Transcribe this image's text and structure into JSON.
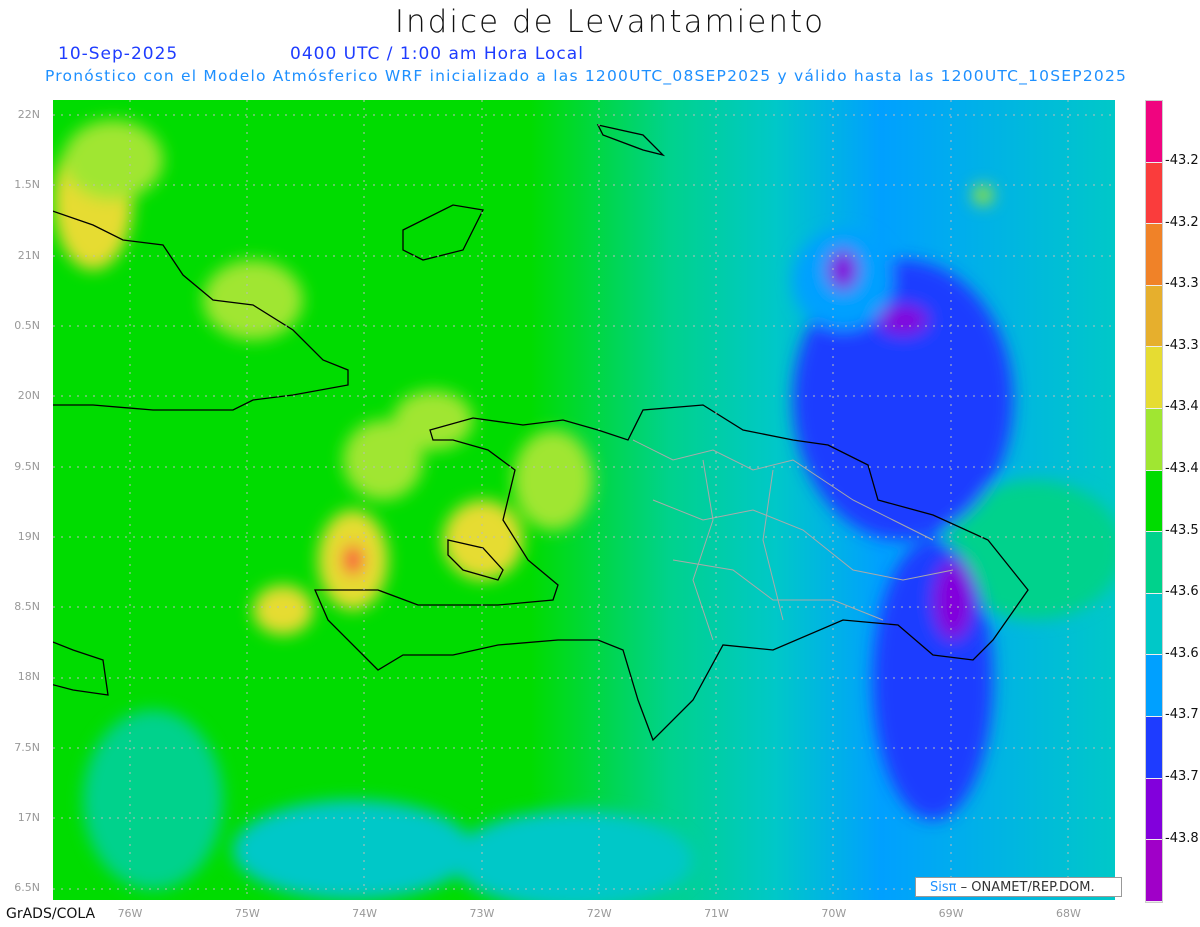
{
  "title": "Indice de Levantamiento",
  "date": "10-Sep-2025",
  "time": "0400 UTC / 1:00 am Hora Local",
  "subtitle": "Pronóstico con el Modelo Atmósferico WRF inicializado a las 1200UTC_08SEP2025 y válido hasta las  1200UTC_10SEP2025",
  "y_axis": [
    "22N",
    "1.5N",
    "21N",
    "0.5N",
    "20N",
    "9.5N",
    "19N",
    "8.5N",
    "18N",
    "7.5N",
    "17N",
    "6.5N"
  ],
  "x_axis": [
    "76W",
    "75W",
    "74W",
    "73W",
    "72W",
    "71W",
    "70W",
    "69W",
    "68W"
  ],
  "colorbar": {
    "labels": [
      "-43.2",
      "-43.2",
      "-43.3",
      "-43.3",
      "-43.4",
      "-43.4",
      "-43.5",
      "-43.6",
      "-43.6",
      "-43.7",
      "-43.7",
      "-43.8"
    ],
    "colors": [
      "#f0047f",
      "#fa3c3c",
      "#f08228",
      "#e6af2d",
      "#e6dc32",
      "#a0e632",
      "#00dc00",
      "#00d28c",
      "#00c8c8",
      "#00a0ff",
      "#1e3cff",
      "#8200dc",
      "#a000c8"
    ]
  },
  "credit": {
    "brand": "Sisπ",
    "text": " – ONAMET/REP.DOM."
  },
  "footer": "GrADS/COLA"
}
